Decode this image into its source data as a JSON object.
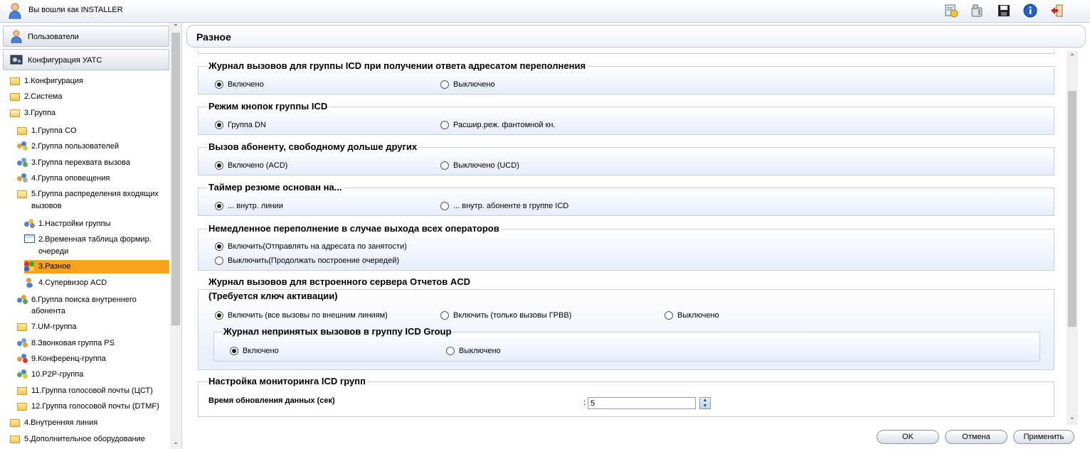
{
  "header": {
    "login_text": "Вы вошли как INSTALLER",
    "icons": [
      "clock-document-icon",
      "phone-list-icon",
      "save-disk-icon",
      "info-icon",
      "logout-icon"
    ]
  },
  "sidebar": {
    "users_label": "Пользователи",
    "pbx_config_label": "Конфигурация УАТС",
    "tree": [
      {
        "label": "1.Конфигурация"
      },
      {
        "label": "2.Система"
      },
      {
        "label": "3.Группа"
      },
      {
        "label": "1.Группа CO"
      },
      {
        "label": "2.Группа пользователей"
      },
      {
        "label": "3.Группа перехвата вызова"
      },
      {
        "label": "4.Группа оповещения"
      },
      {
        "label": "5.Группа распределения входящих"
      },
      {
        "label": "вызовов"
      },
      {
        "label": "1.Настройки группы"
      },
      {
        "label": "2.Временная таблица формир."
      },
      {
        "label": "очереди"
      },
      {
        "label": "3.Разное"
      },
      {
        "label": "4.Супервизор ACD"
      },
      {
        "label": "6.Группа поиска внутреннего"
      },
      {
        "label": "абонента"
      },
      {
        "label": "7.UM-группа"
      },
      {
        "label": "8.Звонковая группа PS"
      },
      {
        "label": "9.Конференц-группа"
      },
      {
        "label": "10.P2P-группа"
      },
      {
        "label": "11.Группа голосовой почты (ЦСТ)"
      },
      {
        "label": "12.Группа голосовой почты (DTMF)"
      },
      {
        "label": "4.Внутренняя линия"
      },
      {
        "label": "5.Дополнительное оборудование"
      }
    ]
  },
  "main": {
    "title": "Разное",
    "groups": {
      "g1": {
        "legend": "Журнал вызовов для группы ICD при получении ответа адресатом переполнения",
        "opt1": "Включено",
        "opt2": "Выключено",
        "selected": 1
      },
      "g2": {
        "legend": "Режим кнопок группы ICD",
        "opt1": "Группа DN",
        "opt2": "Расшир.реж. фантомной кн.",
        "selected": 1
      },
      "g3": {
        "legend": "Вызов абоненту, свободному дольше других",
        "opt1": "Включено (ACD)",
        "opt2": "Выключено (UCD)",
        "selected": 1
      },
      "g4": {
        "legend": "Таймер резюме основан на...",
        "opt1": "... внутр. линии",
        "opt2": "... внутр. абоненте в группе ICD",
        "selected": 1
      },
      "g5": {
        "legend": "Немедленное переполнение в случае выхода всех операторов",
        "opt1": "Включить(Отправлять на адресата по занятости)",
        "opt2": "Выключить(Продолжать построение очередей)",
        "selected": 1
      },
      "g6": {
        "legend_line1": "Журнал вызовов для встроенного сервера Отчетов ACD",
        "legend_line2": "(Требуется ключ активации)",
        "opt1": "Включить (все вызовы по внешним линиям)",
        "opt2": "Включить (только вызовы ГРВВ)",
        "opt3": "Выключено",
        "selected": 1
      },
      "g6sub": {
        "legend": "Журнал непринятых вызовов в группу ICD Group",
        "opt1": "Включено",
        "opt2": "Выключено",
        "selected": 1
      },
      "g7": {
        "legend": "Настройка мониторинга ICD групп",
        "field_label": "Время обновления данных (сек)",
        "colon": ":",
        "value": "5"
      }
    }
  },
  "buttons": {
    "ok": "OK",
    "cancel": "Отмена",
    "apply": "Применить"
  }
}
